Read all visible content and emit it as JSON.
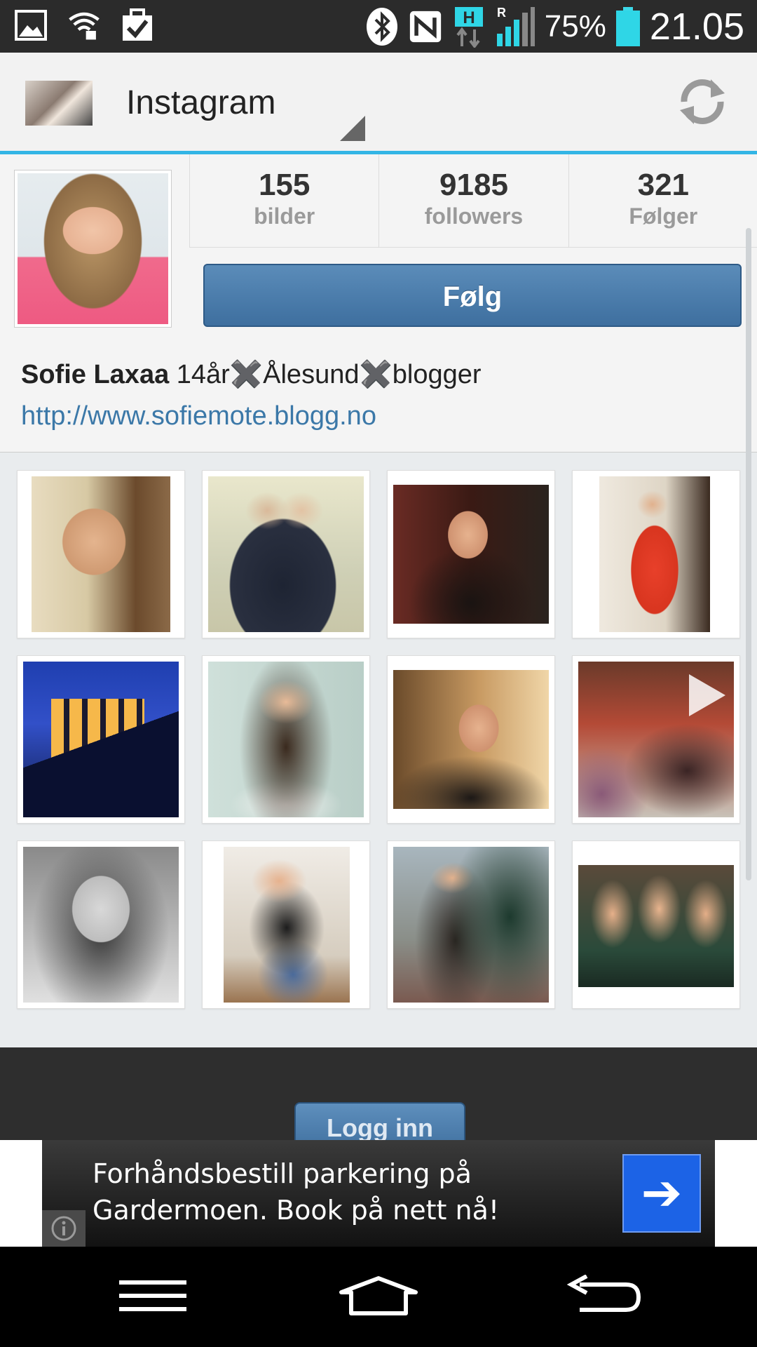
{
  "status_bar": {
    "battery_percent": "75%",
    "time": "21.05",
    "network_type": "H",
    "roaming": "R",
    "icons": [
      "gallery-icon",
      "wifi-icon",
      "task-icon",
      "bluetooth-icon",
      "nfc-icon",
      "data-transfer-icon",
      "signal-icon",
      "battery-icon"
    ]
  },
  "action_bar": {
    "title": "Instagram",
    "icons": [
      "profile-thumbnail",
      "dropdown-indicator-icon",
      "refresh-icon"
    ]
  },
  "profile": {
    "stats": [
      {
        "count": "155",
        "label": "bilder"
      },
      {
        "count": "9185",
        "label": "followers"
      },
      {
        "count": "321",
        "label": "Følger"
      }
    ],
    "follow_label": "Følg"
  },
  "bio": {
    "name": "Sofie Laxaa",
    "text": " 14år✖️Ålesund✖️blogger",
    "link": "http://www.sofiemote.blogg.no"
  },
  "photos": [
    {
      "subject": "selfie-cream-hoodie"
    },
    {
      "subject": "two-girls-hugging"
    },
    {
      "subject": "christmas-tree-portrait"
    },
    {
      "subject": "red-dress"
    },
    {
      "subject": "house-at-night"
    },
    {
      "subject": "white-top-portrait"
    },
    {
      "subject": "black-jacket-portrait"
    },
    {
      "subject": "living-room-video",
      "is_video": true
    },
    {
      "subject": "black-white-selfie"
    },
    {
      "subject": "mirror-selfie"
    },
    {
      "subject": "lace-dress-christmas"
    },
    {
      "subject": "three-girls"
    }
  ],
  "footer": {
    "login_label": "Logg inn"
  },
  "ad": {
    "text": "Forhåndsbestill parkering på Gardermoen. Book på nett nå!",
    "cta_icon": "arrow-right-icon",
    "info_icon": "info-icon"
  },
  "nav_bar": {
    "icons": [
      "menu-icon",
      "home-icon",
      "back-icon"
    ]
  },
  "colors": {
    "accent": "#33b5e5",
    "follow_button": "#4a7cab",
    "link": "#3b78a8",
    "ad_cta": "#1c63e6",
    "battery": "#2fd6e6"
  }
}
